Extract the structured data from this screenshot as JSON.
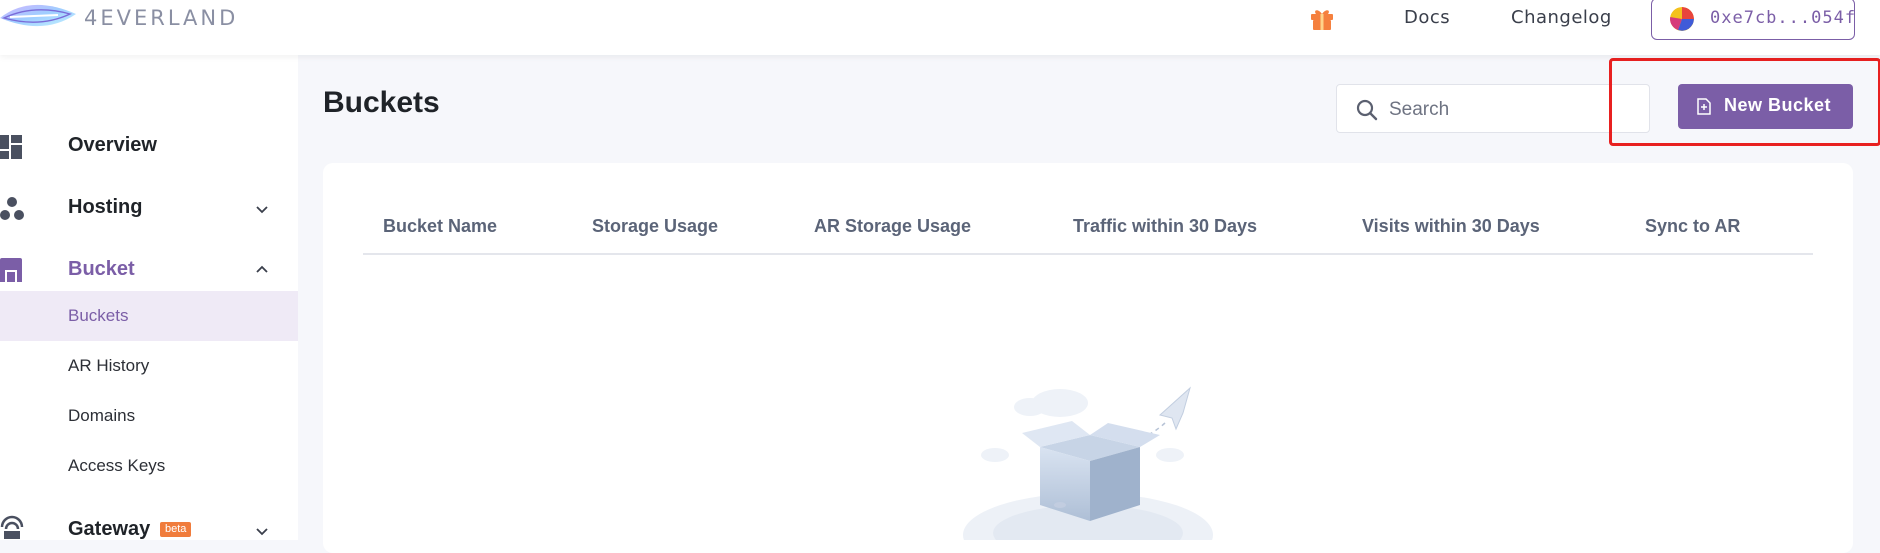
{
  "header": {
    "logo_text": "4EVERLAND",
    "gift_icon": "gift-icon",
    "links": [
      {
        "label": "Docs"
      },
      {
        "label": "Changelog"
      }
    ],
    "wallet": {
      "label": "0xe7cb...054f"
    }
  },
  "sidebar": {
    "overview": {
      "label": "Overview",
      "icon": "dashboard-icon"
    },
    "hosting": {
      "label": "Hosting",
      "icon": "hosting-icon"
    },
    "bucket": {
      "label": "Bucket",
      "icon": "bucket-icon",
      "items": [
        {
          "label": "Buckets",
          "active": true
        },
        {
          "label": "AR History"
        },
        {
          "label": "Domains"
        },
        {
          "label": "Access Keys"
        }
      ]
    },
    "gateway": {
      "label": "Gateway",
      "badge": "beta",
      "icon": "gateway-icon"
    }
  },
  "main": {
    "title": "Buckets",
    "search": {
      "placeholder": "Search"
    },
    "new_bucket_label": "New Bucket",
    "table": {
      "columns": [
        "Bucket Name",
        "Storage Usage",
        "AR Storage Usage",
        "Traffic within 30 Days",
        "Visits within 30 Days",
        "Sync to AR"
      ]
    }
  },
  "colors": {
    "accent": "#7b5ea7",
    "highlight_box": "#e82020",
    "beta_badge": "#f07c3c"
  }
}
